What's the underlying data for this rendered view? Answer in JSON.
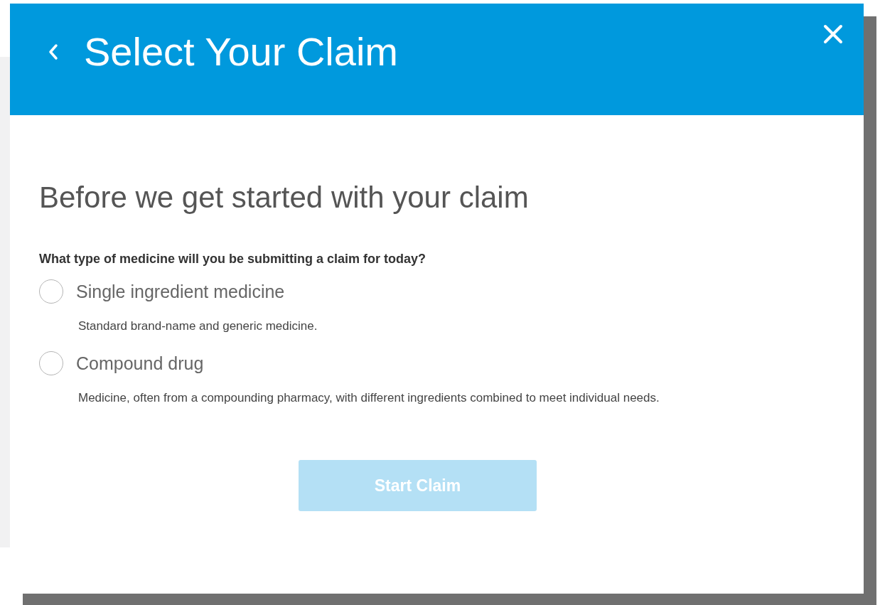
{
  "header": {
    "title": "Select Your Claim"
  },
  "heading": "Before we get started with your claim",
  "question": "What type of medicine will you be submitting a claim for today?",
  "options": [
    {
      "label": "Single ingredient medicine",
      "description": "Standard brand-name and generic medicine.",
      "selected": false
    },
    {
      "label": "Compound drug",
      "description": "Medicine, often from a compounding pharmacy, with different ingredients combined to meet individual needs.",
      "selected": false
    }
  ],
  "button": {
    "label": "Start Claim",
    "disabled": true
  }
}
